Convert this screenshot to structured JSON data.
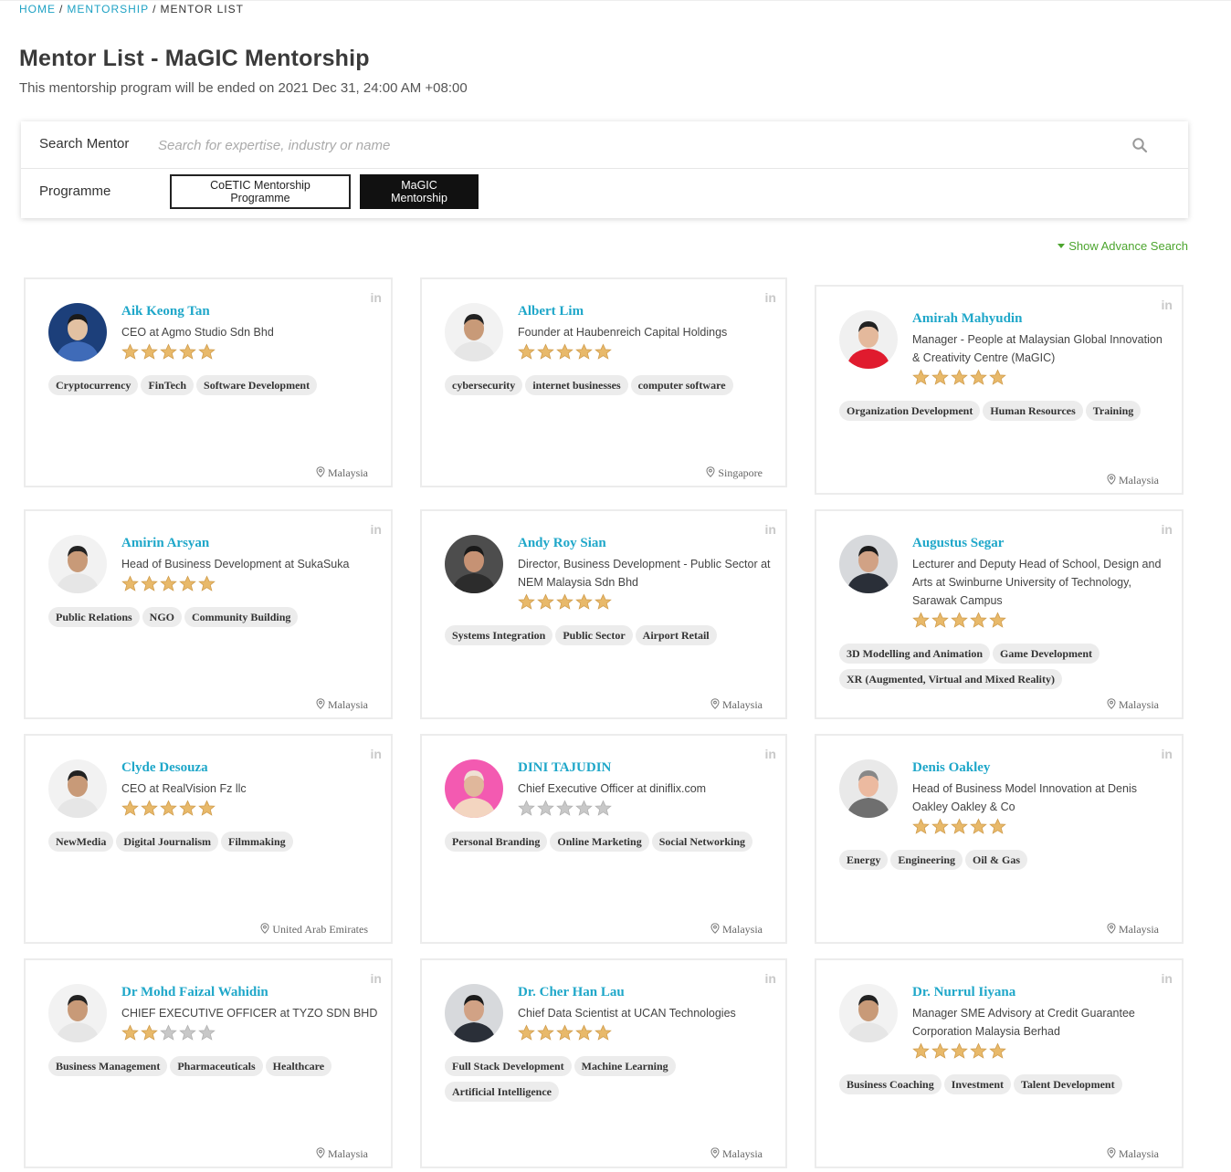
{
  "breadcrumb": {
    "home": "HOME",
    "mentorship": "MENTORSHIP",
    "current": "MENTOR LIST",
    "sep": "/"
  },
  "page": {
    "title": "Mentor List - MaGIC Mentorship",
    "subtitle": "This mentorship program will be ended on 2021 Dec 31, 24:00 AM +08:00"
  },
  "search": {
    "label": "Search Mentor",
    "placeholder": "Search for expertise, industry or name",
    "value": ""
  },
  "programme": {
    "label": "Programme",
    "options": [
      "CoETIC Mentorship Programme",
      "MaGIC Mentorship"
    ],
    "selected": "MaGIC Mentorship"
  },
  "advance_search": "Show Advance Search",
  "colors": {
    "accent": "#1fa7c9",
    "link_green": "#4ca52e",
    "star_gold": "#e8b96a",
    "star_grey": "#c8c8c8"
  },
  "linkedin_label": "in",
  "mentors": [
    {
      "name": "Aik Keong Tan",
      "role": "CEO at Agmo Studio Sdn Bhd",
      "rating": 5,
      "tags": [
        "Cryptocurrency",
        "FinTech",
        "Software Development"
      ],
      "location": "Malaysia",
      "avatar": "avatar-blue"
    },
    {
      "name": "Albert Lim",
      "role": "Founder at Haubenreich Capital Holdings",
      "rating": 5,
      "tags": [
        "cybersecurity",
        "internet businesses",
        "computer software"
      ],
      "location": "Singapore",
      "avatar": "avatar-white"
    },
    {
      "name": "Amirah Mahyudin",
      "role": "Manager - People at Malaysian Global Innovation & Creativity Centre (MaGIC)",
      "rating": 5,
      "tags": [
        "Organization Development",
        "Human Resources",
        "Training"
      ],
      "location": "Malaysia",
      "avatar": "avatar-red"
    },
    {
      "name": "Amirin Arsyan",
      "role": "Head of Business Development at SukaSuka",
      "rating": 5,
      "tags": [
        "Public Relations",
        "NGO",
        "Community Building"
      ],
      "location": "Malaysia",
      "avatar": "avatar-white"
    },
    {
      "name": "Andy Roy Sian",
      "role": "Director, Business Development - Public Sector at NEM Malaysia Sdn Bhd",
      "rating": 5,
      "tags": [
        "Systems Integration",
        "Public Sector",
        "Airport Retail"
      ],
      "location": "Malaysia",
      "avatar": "avatar-dark"
    },
    {
      "name": "Augustus Segar",
      "role": "Lecturer and Deputy Head of School, Design and Arts at Swinburne University of Technology, Sarawak Campus",
      "rating": 5,
      "tags": [
        "3D Modelling and Animation",
        "Game Development",
        "XR (Augmented, Virtual and Mixed Reality)"
      ],
      "location": "Malaysia",
      "avatar": "avatar-grey"
    },
    {
      "name": "Clyde Desouza",
      "role": "CEO at RealVision Fz llc",
      "rating": 5,
      "tags": [
        "NewMedia",
        "Digital Journalism",
        "Filmmaking"
      ],
      "location": "United Arab Emirates",
      "avatar": "avatar-white"
    },
    {
      "name": "DINI TAJUDIN",
      "role": "Chief Executive Officer at diniflix.com",
      "rating": 0,
      "tags": [
        "Personal Branding",
        "Online Marketing",
        "Social Networking"
      ],
      "location": "Malaysia",
      "avatar": "avatar-pink"
    },
    {
      "name": "Denis Oakley",
      "role": "Head of Business Model Innovation at Denis Oakley Oakley & Co",
      "rating": 5,
      "tags": [
        "Energy",
        "Engineering",
        "Oil & Gas"
      ],
      "location": "Malaysia",
      "avatar": "avatar-light"
    },
    {
      "name": "Dr Mohd Faizal Wahidin",
      "role": "CHIEF EXECUTIVE OFFICER at TYZO SDN BHD",
      "rating": 2,
      "tags": [
        "Business Management",
        "Pharmaceuticals",
        "Healthcare"
      ],
      "location": "Malaysia",
      "avatar": "avatar-white"
    },
    {
      "name": "Dr. Cher Han Lau",
      "role": "Chief Data Scientist at UCAN Technologies",
      "rating": 5,
      "tags": [
        "Full Stack Development",
        "Machine Learning",
        "Artificial Intelligence"
      ],
      "location": "Malaysia",
      "avatar": "avatar-grey"
    },
    {
      "name": "Dr. Nurrul Iiyana",
      "role": "Manager SME Advisory at Credit Guarantee Corporation Malaysia Berhad",
      "rating": 5,
      "tags": [
        "Business Coaching",
        "Investment",
        "Talent Development"
      ],
      "location": "Malaysia",
      "avatar": "avatar-white"
    }
  ]
}
